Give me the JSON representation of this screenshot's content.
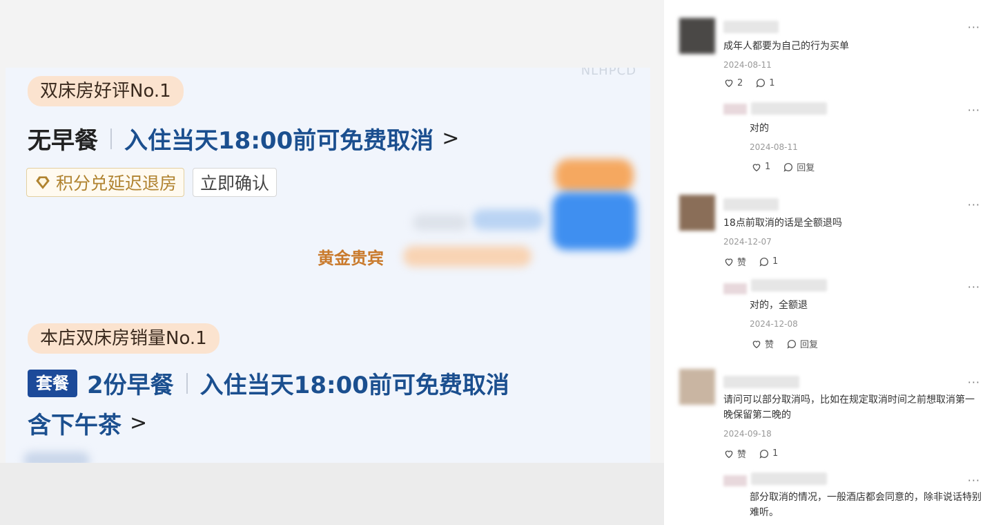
{
  "left": {
    "watermark": "NLHPCD",
    "room1": {
      "badge": "双床房好评No.1",
      "meal": "无早餐",
      "cancel": "入住当天18:00前可免费取消",
      "chevron": ">",
      "tag_points": "积分兑延迟退房",
      "tag_confirm": "立即确认",
      "gold_guest": "黄金贵宾"
    },
    "room2": {
      "badge": "本店双床房销量No.1",
      "package": "套餐",
      "meal": "2份早餐",
      "cancel": "入住当天18:00前可免费取消",
      "extra": "含下午茶",
      "chevron": ">"
    }
  },
  "comments": [
    {
      "text": "成年人都要为自己的行为买单",
      "date": "2024-08-11",
      "likes": "2",
      "replies": "1",
      "reply": {
        "text": "对的",
        "date": "2024-08-11",
        "likes": "1",
        "reply_label": "回复"
      }
    },
    {
      "text": "18点前取消的话是全额退吗",
      "date": "2024-12-07",
      "likes": "赞",
      "replies": "1",
      "reply": {
        "text": "对的，全额退",
        "date": "2024-12-08",
        "likes": "赞",
        "reply_label": "回复"
      }
    },
    {
      "text": "请问可以部分取消吗，比如在规定取消时间之前想取消第一晚保留第二晚的",
      "date": "2024-09-18",
      "likes": "赞",
      "replies": "1",
      "reply": {
        "text": "部分取消的情况，一般酒店都会同意的，除非说话特别难听。"
      }
    }
  ],
  "more_label": "···",
  "colors": {
    "accent_blue": "#1b4f8f",
    "package_blue": "#1c4a99",
    "badge_bg": "#fbe3cf",
    "gold": "#b08330"
  }
}
